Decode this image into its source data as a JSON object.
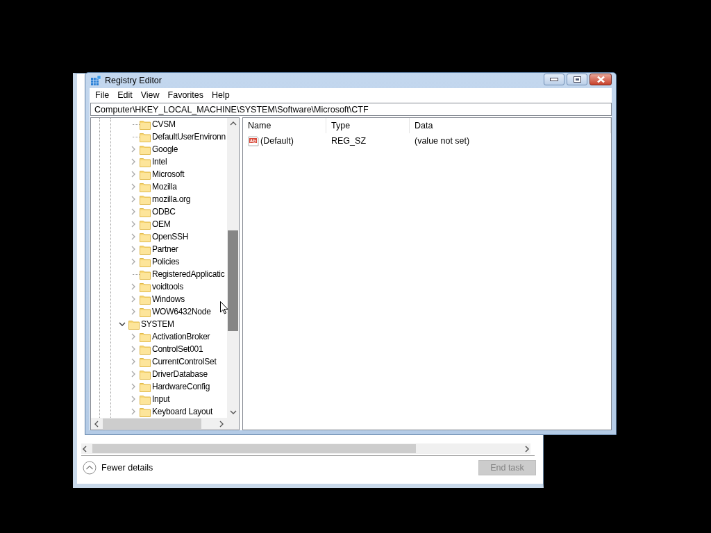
{
  "background_window": {
    "footer_link": "Fewer details",
    "end_task_button": {
      "label": "End task",
      "disabled": true
    }
  },
  "window": {
    "title": "Registry Editor"
  },
  "menu": [
    "File",
    "Edit",
    "View",
    "Favorites",
    "Help"
  ],
  "address": "Computer\\HKEY_LOCAL_MACHINE\\SYSTEM\\Software\\Microsoft\\CTF",
  "tree": [
    {
      "children": [
        {
          "label": "CVSM",
          "expandable": false
        },
        {
          "label": "DefaultUserEnvironn",
          "expandable": false
        },
        {
          "label": "Google",
          "expandable": true,
          "expanded": false
        },
        {
          "label": "Intel",
          "expandable": true,
          "expanded": false
        },
        {
          "label": "Microsoft",
          "expandable": true,
          "expanded": false
        },
        {
          "label": "Mozilla",
          "expandable": true,
          "expanded": false
        },
        {
          "label": "mozilla.org",
          "expandable": true,
          "expanded": false
        },
        {
          "label": "ODBC",
          "expandable": true,
          "expanded": false
        },
        {
          "label": "OEM",
          "expandable": true,
          "expanded": false
        },
        {
          "label": "OpenSSH",
          "expandable": true,
          "expanded": false
        },
        {
          "label": "Partner",
          "expandable": true,
          "expanded": false
        },
        {
          "label": "Policies",
          "expandable": true,
          "expanded": false
        },
        {
          "label": "RegisteredApplicatic",
          "expandable": false
        },
        {
          "label": "voidtools",
          "expandable": true,
          "expanded": false
        },
        {
          "label": "Windows",
          "expandable": true,
          "expanded": false
        },
        {
          "label": "WOW6432Node",
          "expandable": true,
          "expanded": false
        }
      ]
    },
    {
      "label": "SYSTEM",
      "expandable": true,
      "expanded": true,
      "children": [
        {
          "label": "ActivationBroker",
          "expandable": true,
          "expanded": false
        },
        {
          "label": "ControlSet001",
          "expandable": true,
          "expanded": false
        },
        {
          "label": "CurrentControlSet",
          "expandable": true,
          "expanded": false
        },
        {
          "label": "DriverDatabase",
          "expandable": true,
          "expanded": false
        },
        {
          "label": "HardwareConfig",
          "expandable": true,
          "expanded": false
        },
        {
          "label": "Input",
          "expandable": true,
          "expanded": false
        },
        {
          "label": "Keyboard Layout",
          "expandable": true,
          "expanded": false
        }
      ]
    }
  ],
  "values": {
    "columns": [
      "Name",
      "Type",
      "Data"
    ],
    "rows": [
      {
        "name": "(Default)",
        "type": "REG_SZ",
        "data": "(value not set)"
      }
    ]
  }
}
